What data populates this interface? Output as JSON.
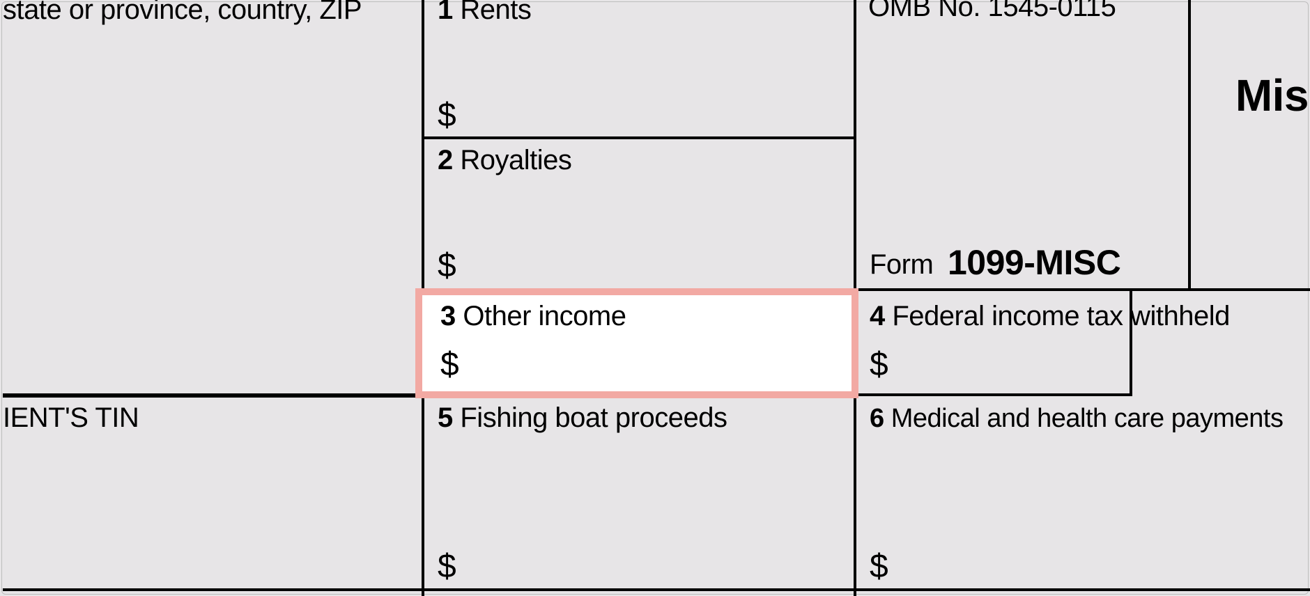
{
  "payer": {
    "address_fragment": "state or province, country, ZIP"
  },
  "recipient": {
    "tin_label_fragment": "IENT'S TIN"
  },
  "header": {
    "omb_fragment": "OMB No. 1545-0115",
    "form_word": "Form",
    "form_number": "1099-MISC",
    "mis_fragment": "Mis"
  },
  "boxes": {
    "b1": {
      "num": "1",
      "label": "Rents",
      "dollar": "$"
    },
    "b2": {
      "num": "2",
      "label": "Royalties",
      "dollar": "$"
    },
    "b3": {
      "num": "3",
      "label": "Other income",
      "dollar": "$"
    },
    "b4": {
      "num": "4",
      "label": "Federal income tax withheld",
      "dollar": "$"
    },
    "b5": {
      "num": "5",
      "label": "Fishing boat proceeds",
      "dollar": "$"
    },
    "b6": {
      "num": "6",
      "label": "Medical and health care payments",
      "dollar": "$"
    }
  }
}
